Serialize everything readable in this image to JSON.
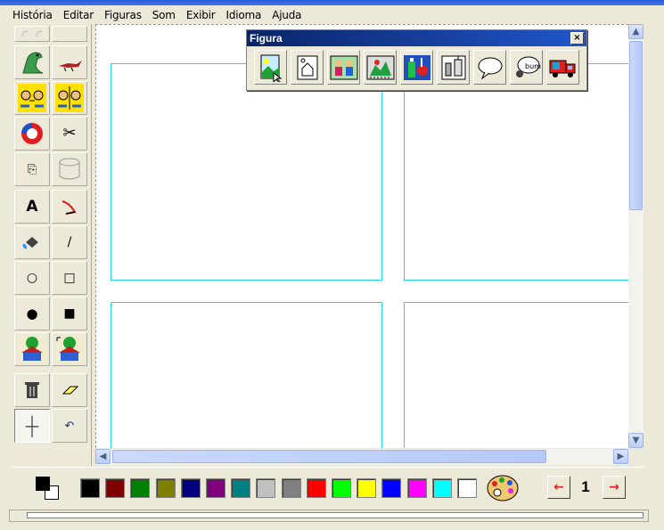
{
  "menu": [
    "História",
    "Editar",
    "Figuras",
    "Som",
    "Exibir",
    "Idioma",
    "Ajuda"
  ],
  "toolbox": {
    "tools": [
      {
        "name": "undo-redo-icon",
        "glyph": "↶↷"
      },
      {
        "name": "blank-tool",
        "glyph": ""
      },
      {
        "name": "character-dragon-icon",
        "glyph": "🐉"
      },
      {
        "name": "bird-figure-icon",
        "glyph": "🐦"
      },
      {
        "name": "flip-horizontal-faces-icon",
        "glyph": "🙂"
      },
      {
        "name": "flip-vertical-faces-icon",
        "glyph": "🙂"
      },
      {
        "name": "rotate-icon",
        "glyph": "⟲"
      },
      {
        "name": "scissors-icon",
        "glyph": "✂"
      },
      {
        "name": "copy-icon",
        "glyph": "⎘"
      },
      {
        "name": "paste-bucket-icon",
        "glyph": "⌓"
      },
      {
        "name": "text-tool-icon",
        "glyph": "A"
      },
      {
        "name": "pen-tool-icon",
        "glyph": "↘"
      },
      {
        "name": "fill-bucket-icon",
        "glyph": "🪣"
      },
      {
        "name": "line-tool-icon",
        "glyph": "/"
      },
      {
        "name": "ellipse-outline-icon",
        "glyph": "○"
      },
      {
        "name": "rectangle-outline-icon",
        "glyph": "□"
      },
      {
        "name": "ellipse-filled-icon",
        "glyph": "●"
      },
      {
        "name": "rectangle-filled-icon",
        "glyph": "■"
      },
      {
        "name": "scene-house-icon",
        "glyph": "🏠"
      },
      {
        "name": "scene-house-alt-icon",
        "glyph": "🏠"
      },
      {
        "name": "trash-icon",
        "glyph": "🗑"
      },
      {
        "name": "eraser-icon",
        "glyph": "◇"
      },
      {
        "name": "crosshair-icon",
        "glyph": "┼"
      },
      {
        "name": "undo-icon",
        "glyph": "↶"
      }
    ]
  },
  "figura_window": {
    "title": "Figura",
    "close_label": "×",
    "buttons": [
      "landscape-figure-icon",
      "house-scene-icon",
      "people-scene-icon",
      "animals-scene-icon",
      "objects-bottle-icon",
      "kitchen-objects-icon",
      "speech-balloon-icon",
      "thought-balloon-icon",
      "vehicle-truck-icon"
    ]
  },
  "palette": {
    "foreground": "#000000",
    "background": "#ffffff",
    "colors": [
      "#000000",
      "#800000",
      "#008000",
      "#808000",
      "#000080",
      "#800080",
      "#008080",
      "#c0c0c0",
      "#808080",
      "#ff0000",
      "#00ff00",
      "#ffff00",
      "#0000ff",
      "#ff00ff",
      "#00ffff",
      "#ffffff"
    ]
  },
  "navigation": {
    "page_number": "1",
    "prev_label": "←",
    "next_label": "→"
  },
  "panels_color": "#21d8e6"
}
